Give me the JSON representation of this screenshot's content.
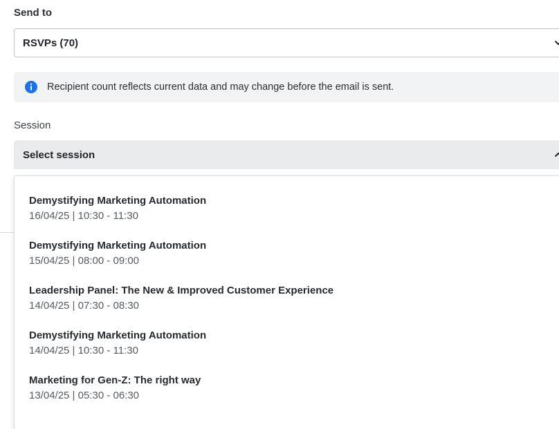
{
  "send_to": {
    "label": "Send to",
    "selected": "RSVPs (70)",
    "chevron_icon": "chevron-down-icon"
  },
  "notice": {
    "icon": "info-icon",
    "color": "#1a73e8",
    "text": "Recipient count reflects current data and may change before the email is sent."
  },
  "session": {
    "label": "Session",
    "placeholder": "Select session",
    "chevron_icon": "chevron-up-icon",
    "options": [
      {
        "title": "Demystifying Marketing Automation",
        "time": "16/04/25 | 10:30 - 11:30"
      },
      {
        "title": "Demystifying Marketing Automation",
        "time": "15/04/25 | 08:00 - 09:00"
      },
      {
        "title": "Leadership Panel: The New & Improved Customer Experience",
        "time": "14/04/25 | 07:30 - 08:30"
      },
      {
        "title": "Demystifying Marketing Automation",
        "time": "14/04/25 | 10:30 - 11:30"
      },
      {
        "title": "Marketing for Gen-Z: The right way",
        "time": "13/04/25 | 05:30 - 06:30"
      }
    ]
  }
}
